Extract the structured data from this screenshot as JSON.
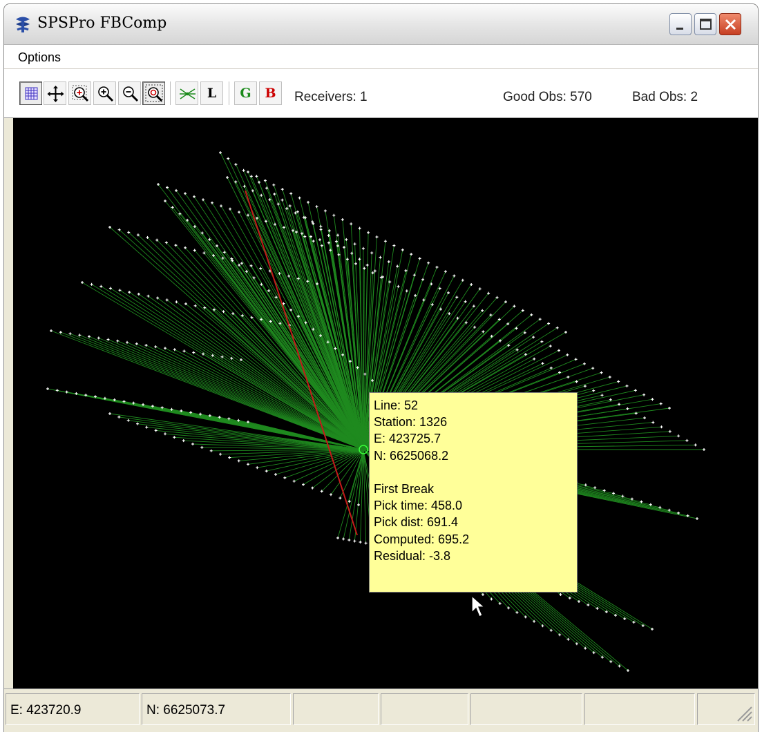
{
  "window": {
    "title": "SPSPro FBComp",
    "icon": "app-logo-icon",
    "controls": [
      "minimize",
      "maximize",
      "close"
    ]
  },
  "menu": {
    "items": [
      {
        "label": "Options"
      }
    ]
  },
  "toolbar": {
    "buttons": [
      {
        "name": "grid-icon",
        "pressed": true
      },
      {
        "name": "pan-icon",
        "pressed": false
      },
      {
        "name": "zoom-window-icon",
        "pressed": false
      },
      {
        "name": "zoom-in-icon",
        "pressed": false
      },
      {
        "name": "zoom-out-icon",
        "pressed": false
      },
      {
        "name": "zoom-extents-icon",
        "pressed": true
      },
      {
        "name": "lines-icon",
        "pressed": false
      }
    ],
    "l_label": "L",
    "g_label": "G",
    "b_label": "B",
    "receivers": "Receivers: 1",
    "good_obs": "Good Obs: 570",
    "bad_obs": "Bad Obs: 2"
  },
  "tooltip": {
    "line": "Line: 52",
    "station": "Station: 1326",
    "easting": "E: 423725.7",
    "northing": "N: 6625068.2",
    "section": "First Break",
    "pick_time": "Pick time: 458.0",
    "pick_dist": "Pick dist: 691.4",
    "computed": "Computed: 695.2",
    "residual": "Residual: -3.8"
  },
  "status": {
    "easting": "E: 423720.9",
    "northing": "N: 6625073.7"
  },
  "colors": {
    "canvas_bg": "#000000",
    "good_ray": "#1f8a1f",
    "bad_ray": "#c41a1a",
    "receiver_marker": "#ffffff",
    "tooltip_bg": "#ffff99",
    "g_button": "#1a8a1a",
    "b_button": "#cc0000"
  }
}
